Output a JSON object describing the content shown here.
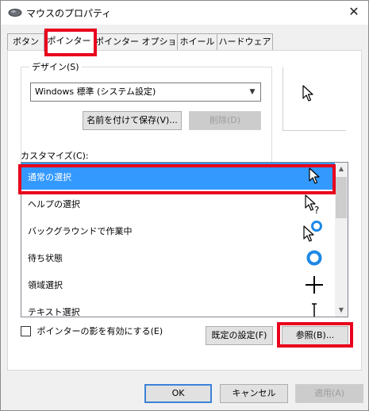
{
  "window": {
    "title": "マウスのプロパティ",
    "close_glyph": "✕"
  },
  "tabs": [
    {
      "label": "ボタン",
      "active": false
    },
    {
      "label": "ポインター",
      "active": true
    },
    {
      "label": "ポインター オプション",
      "active": false
    },
    {
      "label": "ホイール",
      "active": false
    },
    {
      "label": "ハードウェア",
      "active": false
    }
  ],
  "design": {
    "label": "デザイン(S)",
    "scheme_value": "Windows 標準 (システム設定)",
    "save_as_label": "名前を付けて保存(V)...",
    "delete_label": "削除(D)"
  },
  "customize": {
    "label": "カスタマイズ(C):",
    "items": [
      {
        "label": "通常の選択",
        "icon": "arrow-cursor-icon",
        "selected": true
      },
      {
        "label": "ヘルプの選択",
        "icon": "help-cursor-icon",
        "selected": false
      },
      {
        "label": "バックグラウンドで作業中",
        "icon": "working-in-background-cursor-icon",
        "selected": false
      },
      {
        "label": "待ち状態",
        "icon": "busy-cursor-icon",
        "selected": false
      },
      {
        "label": "領域選択",
        "icon": "precision-select-cursor-icon",
        "selected": false
      },
      {
        "label": "テキスト選択",
        "icon": "text-select-cursor-icon",
        "selected": false
      }
    ]
  },
  "shadow_checkbox": {
    "label": "ポインターの影を有効にする(E)",
    "checked": false
  },
  "buttons": {
    "use_default": "既定の設定(F)",
    "browse": "参照(B)...",
    "ok": "OK",
    "cancel": "キャンセル",
    "apply": "適用(A)"
  },
  "colors": {
    "highlight": "#e8001c",
    "selection": "#3399ff"
  }
}
